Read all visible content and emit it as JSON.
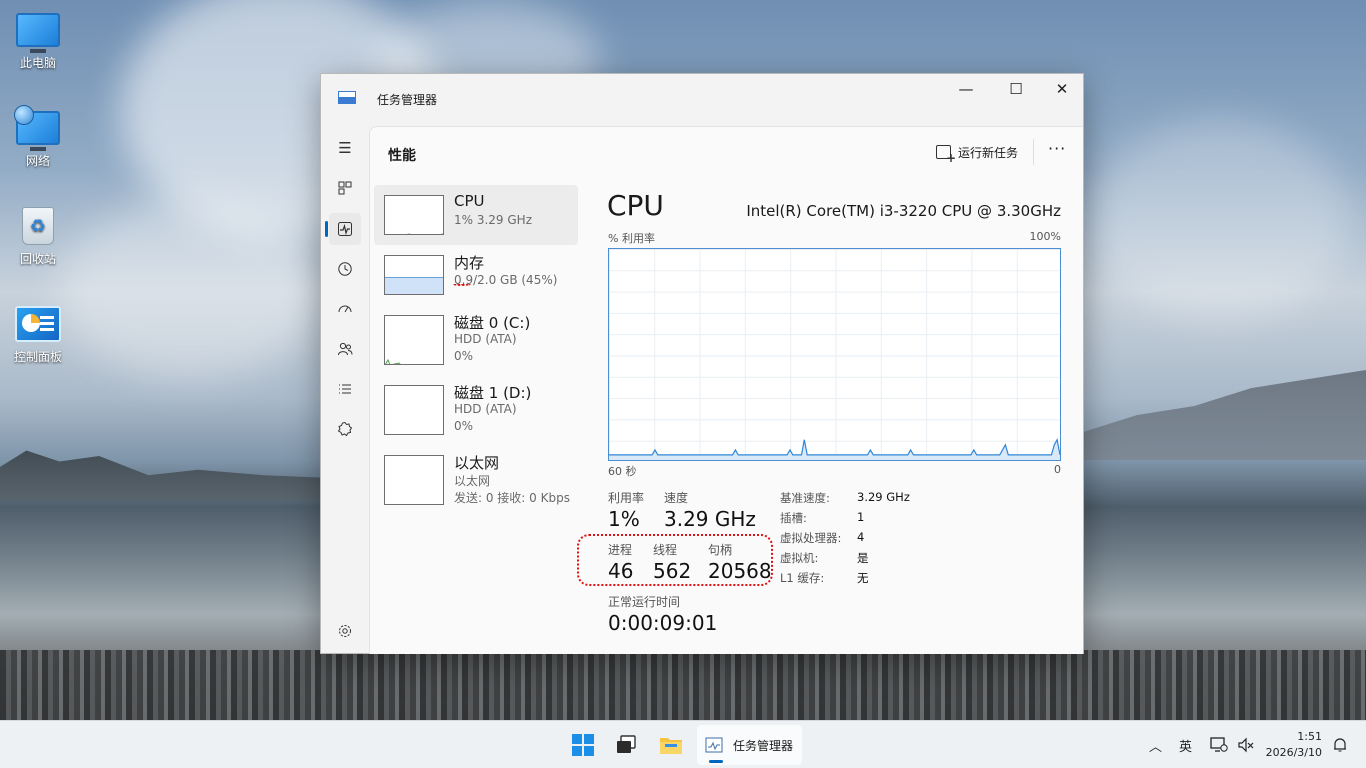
{
  "desktop": {
    "icons": [
      {
        "label": "此电脑"
      },
      {
        "label": "网络"
      },
      {
        "label": "回收站"
      },
      {
        "label": "控制面板"
      }
    ]
  },
  "window": {
    "title": "任务管理器",
    "controls": {
      "minimize": "—",
      "maximize": "☐",
      "close": "✕"
    },
    "page_title": "性能",
    "run_task_label": "运行新任务",
    "more_label": "···"
  },
  "devices": [
    {
      "name": "CPU",
      "line1": "1% 3.29 GHz",
      "line2": ""
    },
    {
      "name": "内存",
      "line1": "0.9/2.0 GB (45%)",
      "line2": ""
    },
    {
      "name": "磁盘 0 (C:)",
      "line1": "HDD (ATA)",
      "line2": "0%"
    },
    {
      "name": "磁盘 1 (D:)",
      "line1": "HDD (ATA)",
      "line2": "0%"
    },
    {
      "name": "以太网",
      "line1": "以太网",
      "line2": "发送: 0 接收: 0 Kbps"
    }
  ],
  "memory_usage_fraction": 0.45,
  "detail": {
    "title": "CPU",
    "model": "Intel(R) Core(TM) i3-3220 CPU @ 3.30GHz",
    "chart_top_left": "% 利用率",
    "chart_top_right": "100%",
    "chart_bottom_left": "60 秒",
    "chart_bottom_right": "0",
    "utilization_label": "利用率",
    "utilization": "1%",
    "speed_label": "速度",
    "speed": "3.29 GHz",
    "processes_label": "进程",
    "processes": "46",
    "threads_label": "线程",
    "threads": "562",
    "handles_label": "句柄",
    "handles": "20568",
    "uptime_label": "正常运行时间",
    "uptime": "0:00:09:01",
    "props": [
      {
        "k": "基准速度:",
        "v": "3.29 GHz"
      },
      {
        "k": "插槽:",
        "v": "1"
      },
      {
        "k": "虚拟处理器:",
        "v": "4"
      },
      {
        "k": "虚拟机:",
        "v": "是"
      },
      {
        "k": "L1 缓存:",
        "v": "无"
      }
    ]
  },
  "cpu_history_percent": [
    1,
    1,
    1,
    1,
    1,
    1,
    1,
    1,
    1,
    1,
    1,
    1,
    1,
    1,
    1,
    1,
    2,
    1,
    1,
    1,
    1,
    1,
    1,
    1,
    1,
    1,
    1,
    1,
    1,
    1,
    1,
    1,
    1,
    1,
    1,
    1,
    1,
    1,
    1,
    1,
    1,
    1,
    1,
    1,
    2,
    1,
    1,
    1,
    1,
    1,
    1,
    1,
    1,
    1,
    1,
    1,
    1,
    1,
    1,
    1,
    1,
    1,
    1,
    2,
    1,
    1,
    1,
    1,
    4,
    1,
    1,
    1,
    1,
    1,
    1,
    1,
    1,
    1,
    1,
    1,
    1,
    1,
    1,
    1,
    1,
    1,
    1,
    1,
    1,
    1,
    1,
    2,
    1,
    1,
    1,
    1,
    1,
    1,
    1,
    1,
    1,
    1,
    1,
    1,
    1,
    2,
    1,
    1,
    1,
    1,
    1,
    1,
    1,
    1,
    1,
    1,
    1,
    1,
    1,
    1,
    1,
    1,
    1,
    1,
    1,
    1,
    1,
    2,
    1,
    1,
    1,
    1,
    1,
    1,
    1,
    1,
    1,
    2,
    3,
    1,
    1,
    1,
    1,
    1,
    1,
    1,
    1,
    1,
    1,
    1,
    1,
    1,
    1,
    1,
    1,
    3,
    4,
    1
  ],
  "taskbar": {
    "task_label": "任务管理器",
    "ime": "英",
    "time": "1:51",
    "date": "2026/3/10"
  }
}
